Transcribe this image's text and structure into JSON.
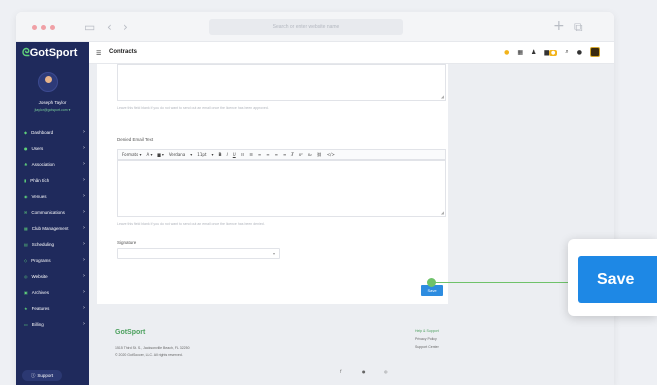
{
  "browser": {
    "url_placeholder": "Search or enter website name"
  },
  "brand": {
    "logo_prefix": "Got",
    "logo_suffix": "Sport"
  },
  "header": {
    "title": "Contracts"
  },
  "user": {
    "name": "Joseph Taylor",
    "email": "jtaylor@gotsport.com ▾"
  },
  "sidebar": {
    "items": [
      {
        "label": "Dashboard",
        "icon": "dashboard-icon"
      },
      {
        "label": "Users",
        "icon": "users-icon"
      },
      {
        "label": "Association",
        "icon": "association-icon"
      },
      {
        "label": "Phân tích",
        "icon": "chart-icon"
      },
      {
        "label": "Venues",
        "icon": "venue-icon"
      },
      {
        "label": "Communications",
        "icon": "communications-icon"
      },
      {
        "label": "Club Management",
        "icon": "club-icon"
      },
      {
        "label": "Scheduling",
        "icon": "calendar-icon"
      },
      {
        "label": "Programs",
        "icon": "programs-icon"
      },
      {
        "label": "Website",
        "icon": "globe-icon"
      },
      {
        "label": "Archives",
        "icon": "archive-icon"
      },
      {
        "label": "Features",
        "icon": "star-icon"
      },
      {
        "label": "Billing",
        "icon": "billing-icon"
      }
    ],
    "support_label": "Support"
  },
  "form": {
    "approved_helper": "Leave this field blank if you do not want to send out an email once the licence has been approved.",
    "denied_label": "Denied Email Text",
    "toolbar": {
      "formats": "Formats ▾",
      "font": "Verdana",
      "size": "11pt"
    },
    "denied_helper": "Leave this field blank if you do not want to send out an email once the licence has been denied.",
    "signature_label": "Signature",
    "save_label": "Save"
  },
  "footer": {
    "logo": "GotSport",
    "address": "1515 Third St. S., Jacksonville Beach, FL 32250",
    "copyright": "© 2020 GotSoccer, LLC. All rights reserved.",
    "links": [
      "Help & Support",
      "Privacy Policy",
      "Support Center"
    ]
  },
  "callout": {
    "label": "Save",
    "color": "#1e88e5"
  }
}
